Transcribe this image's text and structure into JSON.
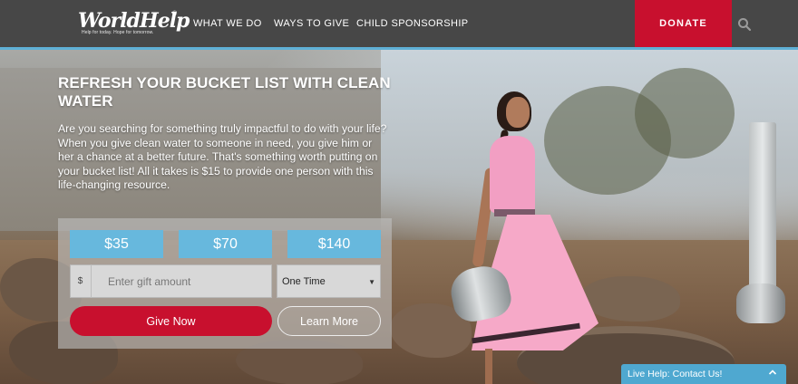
{
  "header": {
    "logo_text": "WorldHelp",
    "logo_reg": "®",
    "logo_tagline": "Help for today. Hope for tomorrow.",
    "nav": [
      "WHAT WE DO",
      "WAYS TO GIVE",
      "CHILD SPONSORSHIP"
    ],
    "donate_label": "DONATE",
    "search_icon": "search-icon"
  },
  "hero": {
    "title": "REFRESH YOUR BUCKET LIST WITH CLEAN WATER",
    "body": "Are you searching for something truly impactful to do with your life? When you give clean water to someone in need, you give him or her a chance at a better future. That's something worth putting on your bucket list! All it takes is $15 to provide one person with this life-changing resource."
  },
  "donation": {
    "amounts": [
      "$35",
      "$70",
      "$140"
    ],
    "currency_symbol": "$",
    "gift_placeholder": "Enter gift amount",
    "gift_value": "",
    "frequency": "One Time",
    "give_label": "Give Now",
    "learn_label": "Learn More"
  },
  "live_help": {
    "label": "Live Help: Contact Us!"
  },
  "colors": {
    "brand_red": "#c8102e",
    "accent_blue": "#67b8dd",
    "header_gray": "#474747"
  }
}
